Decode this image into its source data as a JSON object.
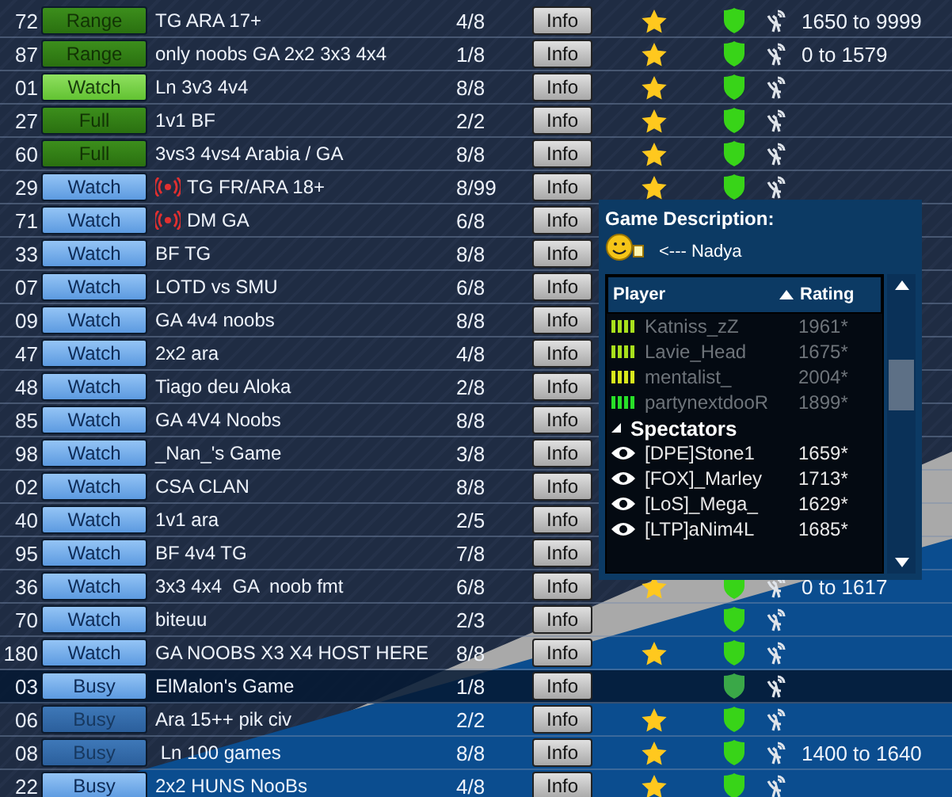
{
  "games": [
    {
      "id": "72",
      "button": {
        "label": "Range",
        "kind": "green_dim"
      },
      "live": false,
      "name": "TG ARA 17+",
      "players": "4/8",
      "info": "Info",
      "starred": true,
      "shield_dimmed": false,
      "range": "1650 to 9999",
      "selected": false
    },
    {
      "id": "87",
      "button": {
        "label": "Range",
        "kind": "green_dim"
      },
      "live": false,
      "name": "only noobs GA 2x2 3x3 4x4",
      "players": "1/8",
      "info": "Info",
      "starred": true,
      "shield_dimmed": false,
      "range": "0 to 1579",
      "selected": false
    },
    {
      "id": "01",
      "button": {
        "label": "Watch",
        "kind": "green_bright"
      },
      "live": false,
      "name": "Ln 3v3 4v4",
      "players": "8/8",
      "info": "Info",
      "starred": true,
      "shield_dimmed": false,
      "selected": false
    },
    {
      "id": "27",
      "button": {
        "label": "Full",
        "kind": "green_dim"
      },
      "live": false,
      "name": "1v1 BF",
      "players": "2/2",
      "info": "Info",
      "starred": true,
      "shield_dimmed": false,
      "selected": false
    },
    {
      "id": "60",
      "button": {
        "label": "Full",
        "kind": "green_dim"
      },
      "live": false,
      "name": "3vs3 4vs4 Arabia / GA",
      "players": "8/8",
      "info": "Info",
      "starred": true,
      "shield_dimmed": false,
      "selected": false
    },
    {
      "id": "29",
      "button": {
        "label": "Watch",
        "kind": "blue"
      },
      "live": true,
      "name": "TG FR/ARA 18+",
      "players": "8/99",
      "info": "Info",
      "starred": true,
      "shield_dimmed": false,
      "selected": false
    },
    {
      "id": "71",
      "button": {
        "label": "Watch",
        "kind": "blue"
      },
      "live": true,
      "name": "DM GA",
      "players": "6/8",
      "info": "Info",
      "selected": false
    },
    {
      "id": "33",
      "button": {
        "label": "Watch",
        "kind": "blue"
      },
      "live": false,
      "name": "BF TG",
      "players": "8/8",
      "info": "Info",
      "selected": false
    },
    {
      "id": "07",
      "button": {
        "label": "Watch",
        "kind": "blue"
      },
      "live": false,
      "name": "LOTD vs SMU",
      "players": "6/8",
      "info": "Info",
      "selected": false
    },
    {
      "id": "09",
      "button": {
        "label": "Watch",
        "kind": "blue"
      },
      "live": false,
      "name": "GA 4v4 noobs",
      "players": "8/8",
      "info": "Info",
      "selected": false
    },
    {
      "id": "47",
      "button": {
        "label": "Watch",
        "kind": "blue"
      },
      "live": false,
      "name": "2x2 ara",
      "players": "4/8",
      "info": "Info",
      "selected": false
    },
    {
      "id": "48",
      "button": {
        "label": "Watch",
        "kind": "blue"
      },
      "live": false,
      "name": "Tiago deu Aloka",
      "players": "2/8",
      "info": "Info",
      "selected": false
    },
    {
      "id": "85",
      "button": {
        "label": "Watch",
        "kind": "blue"
      },
      "live": false,
      "name": "GA 4V4 Noobs",
      "players": "8/8",
      "info": "Info",
      "selected": false
    },
    {
      "id": "98",
      "button": {
        "label": "Watch",
        "kind": "blue"
      },
      "live": false,
      "name": "_Nan_'s Game",
      "players": "3/8",
      "info": "Info",
      "selected": false
    },
    {
      "id": "02",
      "button": {
        "label": "Watch",
        "kind": "blue"
      },
      "live": false,
      "name": "CSA CLAN",
      "players": "8/8",
      "info": "Info",
      "selected": false
    },
    {
      "id": "40",
      "button": {
        "label": "Watch",
        "kind": "blue"
      },
      "live": false,
      "name": "1v1 ara",
      "players": "2/5",
      "info": "Info",
      "selected": false
    },
    {
      "id": "95",
      "button": {
        "label": "Watch",
        "kind": "blue"
      },
      "live": false,
      "name": "BF 4v4 TG",
      "players": "7/8",
      "info": "Info",
      "selected": false
    },
    {
      "id": "36",
      "button": {
        "label": "Watch",
        "kind": "blue"
      },
      "live": false,
      "name": "3x3 4x4  GA  noob fmt",
      "players": "6/8",
      "info": "Info",
      "starred": true,
      "shield_dimmed": false,
      "range": "0 to 1617",
      "selected": false
    },
    {
      "id": "70",
      "button": {
        "label": "Watch",
        "kind": "blue"
      },
      "live": false,
      "name": "biteuu",
      "players": "2/3",
      "info": "Info",
      "starred": false,
      "shield_dimmed": false,
      "selected": false
    },
    {
      "id": "180",
      "button": {
        "label": "Watch",
        "kind": "blue"
      },
      "live": false,
      "name": "GA NOOBS X3 X4 HOST HERE",
      "players": "8/8",
      "info": "Info",
      "starred": true,
      "shield_dimmed": false,
      "selected": false
    },
    {
      "id": "03",
      "button": {
        "label": "Busy",
        "kind": "blue"
      },
      "live": false,
      "name": "ElMalon's Game",
      "players": "1/8",
      "info": "Info",
      "starred": false,
      "shield_dimmed": true,
      "selected": true
    },
    {
      "id": "06",
      "button": {
        "label": "Busy",
        "kind": "blue_dim"
      },
      "live": false,
      "name": "Ara 15++ pik civ",
      "players": "2/2",
      "info": "Info",
      "starred": true,
      "shield_dimmed": false,
      "selected": false
    },
    {
      "id": "08",
      "button": {
        "label": "Busy",
        "kind": "blue_dim"
      },
      "live": false,
      "name": " Ln 100 games",
      "players": "8/8",
      "info": "Info",
      "starred": true,
      "shield_dimmed": false,
      "range": "1400 to 1640",
      "selected": false
    },
    {
      "id": "22",
      "button": {
        "label": "Busy",
        "kind": "blue"
      },
      "live": false,
      "name": "2x2 HUNS NooBs",
      "players": "4/8",
      "info": "Info",
      "starred": true,
      "shield_dimmed": false,
      "selected": false
    }
  ],
  "popup": {
    "title": "Game Description:",
    "description": "<--- Nadya",
    "columns": [
      "Player",
      "Rating"
    ],
    "players": [
      {
        "name": "Katniss_zZ",
        "rating": "1961*",
        "color": "#a8e01c"
      },
      {
        "name": "Lavie_Head",
        "rating": "1675*",
        "color": "#a8e01c"
      },
      {
        "name": "mentalist_",
        "rating": "2004*",
        "color": "#d8e81c"
      },
      {
        "name": "partynextdooR",
        "rating": "1899*",
        "color": "#28e028"
      }
    ],
    "spectators_label": "Spectators",
    "spectators": [
      {
        "name": "[DPE]Stone1",
        "rating": "1659*"
      },
      {
        "name": "[FOX]_Marley",
        "rating": "1713*"
      },
      {
        "name": "[LoS]_Mega_",
        "rating": "1629*"
      },
      {
        "name": "[LTP]aNim4L",
        "rating": "1685*"
      }
    ]
  }
}
